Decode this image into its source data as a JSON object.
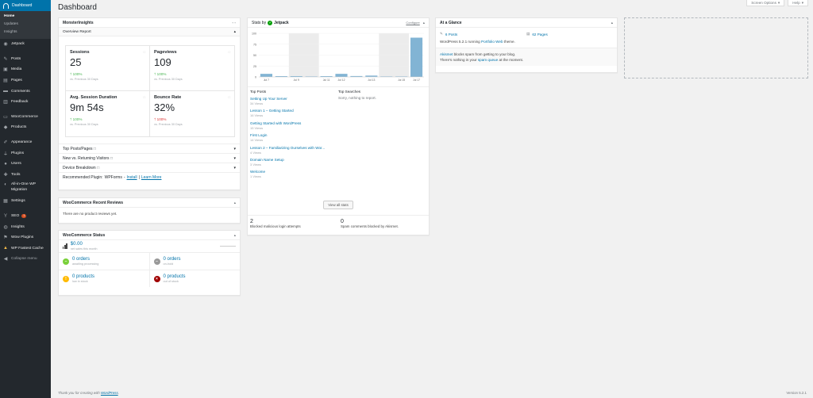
{
  "sidebar": {
    "dashboard": "Dashboard",
    "submenu": [
      "Home",
      "Updates",
      "Insights"
    ],
    "items_a": [
      {
        "label": "Jetpack",
        "icon": "jetpack-icon"
      }
    ],
    "items_b": [
      {
        "label": "Posts",
        "icon": "pin-icon"
      },
      {
        "label": "Media",
        "icon": "media-icon"
      },
      {
        "label": "Pages",
        "icon": "pages-icon"
      },
      {
        "label": "Comments",
        "icon": "comments-icon"
      },
      {
        "label": "Feedback",
        "icon": "feedback-icon"
      }
    ],
    "items_c": [
      {
        "label": "WooCommerce",
        "icon": "woocommerce-icon"
      },
      {
        "label": "Products",
        "icon": "products-icon"
      }
    ],
    "items_d": [
      {
        "label": "Appearance",
        "icon": "brush-icon"
      },
      {
        "label": "Plugins",
        "icon": "plug-icon"
      },
      {
        "label": "Users",
        "icon": "users-icon"
      },
      {
        "label": "Tools",
        "icon": "wrench-icon"
      }
    ],
    "migration_label": "All-in-One WP Migration",
    "settings": "Settings",
    "seo": "SEO",
    "seo_badge": "1",
    "insights": "Insights",
    "wow_plugins": "Wow Plugins",
    "wp_fastest_cache": "WP Fastest Cache",
    "collapse": "Collapse menu"
  },
  "topbar": {
    "screen_options": "Screen Options",
    "help": "Help",
    "caret": "▾"
  },
  "page_title": "Dashboard",
  "monsterinsights": {
    "title": "MonsterInsights",
    "overview": "Overview Report",
    "metrics": [
      {
        "title": "Sessions",
        "value": "25",
        "change": "100%",
        "arrow": "🡑",
        "compare": "vs. Previous 30 Days"
      },
      {
        "title": "Pageviews",
        "value": "109",
        "change": "100%",
        "arrow": "🡑",
        "compare": "vs. Previous 30 Days"
      },
      {
        "title": "Avg. Session Duration",
        "value": "9m 54s",
        "change": "100%",
        "arrow": "🡑",
        "compare": "vs. Previous 30 Days"
      },
      {
        "title": "Bounce Rate",
        "value": "32%",
        "change": "100%",
        "arrow": "🡑",
        "compare": "vs. Previous 30 Days"
      }
    ],
    "collapsed": [
      "Top Posts/Pages",
      "New vs. Returning Visitors",
      "Device Breakdown"
    ],
    "recommended": "Recommended Plugin:",
    "recommended_plugin": "WPForms",
    "install": "Install",
    "learn_more": "Learn More"
  },
  "woo_reviews": {
    "title": "WooCommerce Recent Reviews",
    "empty": "There are no product reviews yet."
  },
  "woo_status": {
    "title": "WooCommerce Status",
    "sales": "$0.00",
    "sales_caption": "net sales this month",
    "cells": [
      {
        "value": "0 orders",
        "caption": "awaiting processing",
        "color": "#7ad03a",
        "glyph": "–"
      },
      {
        "value": "0 orders",
        "caption": "on-hold",
        "color": "#999999",
        "glyph": "–"
      },
      {
        "value": "0 products",
        "caption": "low in stock",
        "color": "#ffba00",
        "glyph": "!"
      },
      {
        "value": "0 products",
        "caption": "out of stock",
        "color": "#a00000",
        "glyph": "×"
      }
    ]
  },
  "stats": {
    "title": "Stats by",
    "brand": "Jetpack",
    "configure": "Configure",
    "top_posts_label": "Top Posts",
    "top_searches_label": "Top Searches",
    "no_searches": "Sorry, nothing to report.",
    "top_posts": [
      {
        "title": "Setting Up Your Server",
        "views": "34 Views"
      },
      {
        "title": "Lesson 1 – Getting Started",
        "views": "16 Views"
      },
      {
        "title": "Getting Started with WordPress",
        "views": "15 Views"
      },
      {
        "title": "First Login",
        "views": "14 Views"
      },
      {
        "title": "Lesson 2 – Familiarizing Ourselves with Wor...",
        "views": "4 Views"
      },
      {
        "title": "Domain Name Setup",
        "views": "3 Views"
      },
      {
        "title": "Welcome",
        "views": "1 Views"
      }
    ],
    "view_all": "View all stats",
    "blocked_count": "2",
    "blocked_label": "Blocked malicious login attempts",
    "spam_count": "0",
    "spam_label": "Spam comments blocked by Akismet."
  },
  "chart_data": {
    "type": "bar",
    "categories": [
      "Jul 7",
      "",
      "Jul 9",
      "",
      "Jul 11",
      "Jul 12",
      "Jul 13",
      "",
      "Jul 15",
      "",
      "Jul 17"
    ],
    "values": [
      7,
      1,
      1,
      0,
      1,
      7,
      2,
      3,
      0,
      0,
      90
    ],
    "yticks": [
      0,
      25,
      50,
      75,
      100
    ],
    "ylim": [
      0,
      100
    ],
    "tick_labels": [
      {
        "index": 0,
        "text": "Jul 7"
      },
      {
        "index": 2,
        "text": "Jul 9"
      },
      {
        "index": 4,
        "text": "Jul 11"
      },
      {
        "index": 5,
        "text": "Jul 12"
      },
      {
        "index": 7,
        "text": "Jul 13"
      },
      {
        "index": 9,
        "text": "Jul 15"
      },
      {
        "index": 10,
        "text": "Jul 17"
      }
    ],
    "weekend_bands": [
      [
        2,
        3
      ],
      [
        8,
        9
      ]
    ],
    "color": "#82b4d4"
  },
  "glance": {
    "title": "At a Glance",
    "posts": "6 Posts",
    "pages": "62 Pages",
    "wp_text": "WordPress 5.2.1 running",
    "theme": "Portfolio Web",
    "theme_suffix": "theme.",
    "akismet": "Akismet",
    "akismet_text": "blocks spam from getting to your blog.",
    "queue_pre": "There's nothing in your",
    "queue_link": "spam queue",
    "queue_post": "at the moment."
  },
  "footer": {
    "thanks": "Thank you for creating with",
    "wp": "WordPress",
    "version": "Version 5.2.1"
  }
}
